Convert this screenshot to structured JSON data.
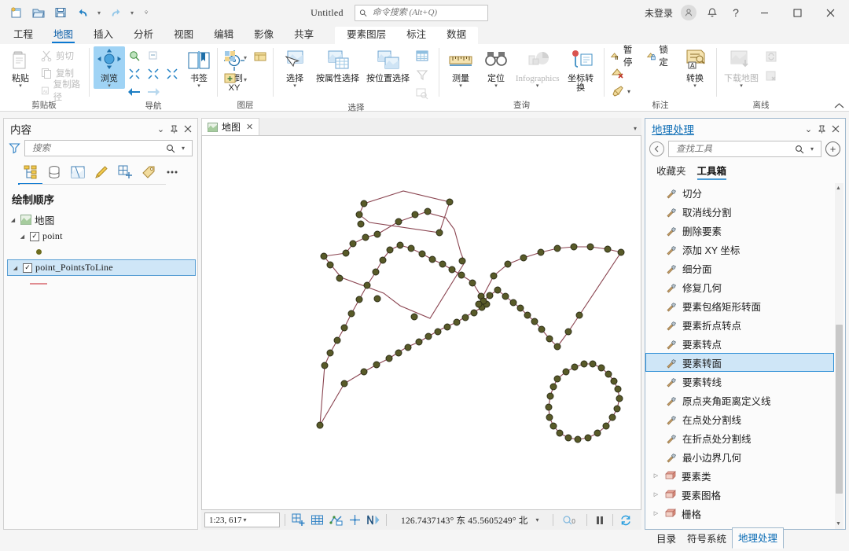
{
  "titlebar": {
    "app_title": "Untitled",
    "search_placeholder": "命令搜索 (Alt+Q)",
    "signin_label": "未登录",
    "qat": [
      {
        "name": "new-project-icon",
        "tip": "新建工程"
      },
      {
        "name": "open-project-icon",
        "tip": "打开工程"
      },
      {
        "name": "save-project-icon",
        "tip": "保存工程"
      },
      {
        "name": "undo-icon",
        "tip": "撤销"
      },
      {
        "name": "redo-icon",
        "tip": "重做"
      },
      {
        "name": "customize-qat-icon",
        "tip": "自定义快速访问工具栏"
      }
    ],
    "help_label": "?",
    "minimize_label": "—",
    "maximize_label": "□",
    "close_label": "✕"
  },
  "ribbon_tabs": {
    "main": [
      "工程",
      "地图",
      "插入",
      "分析",
      "视图",
      "编辑",
      "影像",
      "共享"
    ],
    "active": "地图",
    "contextual": [
      "要素图层",
      "标注",
      "数据"
    ]
  },
  "ribbon": {
    "groups": [
      {
        "label": "剪贴板",
        "big": {
          "label": "粘贴",
          "icon": "paste-icon",
          "caret": true
        },
        "small": [
          {
            "label": "剪切",
            "icon": "cut-icon",
            "dim": true
          },
          {
            "label": "复制",
            "icon": "copy-icon",
            "dim": true
          },
          {
            "label": "复制路径",
            "icon": "copy-path-icon",
            "dim": true
          }
        ]
      },
      {
        "label": "导航",
        "items": [
          {
            "label": "浏览",
            "icon": "explore-icon",
            "selected": true,
            "caret": true
          },
          {
            "label": "书签",
            "icon": "bookmarks-icon",
            "caret": true
          },
          {
            "label": "转到 XY",
            "icon": "go-to-xy-icon",
            "line2": "XY"
          }
        ],
        "minis": [
          "fixed-zoom-in-icon",
          "fixed-zoom-out-icon",
          "previous-extent-icon",
          "next-extent-icon",
          "full-extent-icon",
          "zoom-to-selection-icon"
        ]
      },
      {
        "label": "图层",
        "minis": [
          "layer-basemap-icon",
          "layer-list-icon",
          "add-data-icon"
        ]
      },
      {
        "label": "选择",
        "items": [
          {
            "label": "选择",
            "icon": "select-icon",
            "caret": true
          },
          {
            "label": "按属性选择",
            "icon": "select-by-attribute-icon"
          },
          {
            "label": "按位置选择",
            "icon": "select-by-location-icon"
          }
        ],
        "minis": [
          "attribute-table-icon",
          "selection-clear-icon",
          "zoom-to-selection2-icon"
        ]
      },
      {
        "label": "查询",
        "items": [
          {
            "label": "测量",
            "icon": "measure-icon",
            "caret": true
          },
          {
            "label": "定位",
            "icon": "locate-icon",
            "caret": true
          },
          {
            "label": "Infographics",
            "icon": "infographics-icon",
            "dim": true,
            "caret": true
          },
          {
            "label": "坐标转换",
            "icon": "coordinate-conversion-icon"
          }
        ]
      },
      {
        "label": "标注",
        "small": [
          {
            "label": "暂停",
            "icon": "pause-labeling-icon"
          },
          {
            "label": "锁定",
            "icon": "lock-labeling-icon"
          }
        ],
        "minis": [
          "clear-labels-icon",
          "label-style-icon"
        ],
        "big": {
          "label": "转换",
          "icon": "convert-labels-icon",
          "caret": true
        }
      },
      {
        "label": "离线",
        "big": {
          "label": "下载地图",
          "icon": "download-map-icon",
          "dim": true,
          "caret": true
        },
        "minis": [
          "sync-icon",
          "remove-offline-icon"
        ]
      }
    ]
  },
  "contents_panel": {
    "title": "内容",
    "search_placeholder": "搜索",
    "tools": [
      {
        "name": "drawing-order-icon",
        "active": true
      },
      {
        "name": "data-source-icon",
        "active": false
      },
      {
        "name": "selection-icon",
        "active": false
      },
      {
        "name": "editing-icon",
        "active": false
      },
      {
        "name": "snapping-icon",
        "active": false
      },
      {
        "name": "labeling-icon",
        "active": false
      },
      {
        "name": "more-options-icon",
        "active": false
      }
    ],
    "section_title": "绘制顺序",
    "tree": [
      {
        "label": "地图",
        "type": "map",
        "indent": 0,
        "checkbox": false,
        "expander": true
      },
      {
        "label": "point",
        "type": "point-layer",
        "indent": 1,
        "checkbox": true,
        "checked": true,
        "expander": true,
        "symbol": "point"
      },
      {
        "label": "point_PointsToLine",
        "type": "line-layer",
        "indent": 1,
        "checkbox": true,
        "checked": true,
        "expander": true,
        "symbol": "line",
        "selected": true
      }
    ],
    "point_symbol_color": "#6d6c1e",
    "line_symbol_color": "#e08c91"
  },
  "map_view": {
    "tab_label": "地图",
    "tab_close": "✕",
    "scale": "1:23, 617",
    "coordinates": "126.7437143° 东  45.5605249° 北",
    "status_icons": [
      "add-grid-icon",
      "grid-table-icon",
      "snapping-toggle-icon",
      "crosshair-icon",
      "north-arrow-icon"
    ],
    "right_status": {
      "selection_count": "0",
      "pause_icon": "pause-drawing-icon",
      "refresh_icon": "refresh-icon"
    },
    "line_color": "#8a4450",
    "point_fill": "#585a28",
    "point_stroke": "#32331a"
  },
  "geoprocessing_panel": {
    "title": "地理处理",
    "search_placeholder": "查找工具",
    "tabs": [
      {
        "label": "收藏夹",
        "active": false
      },
      {
        "label": "工具箱",
        "active": true
      }
    ],
    "tools": [
      {
        "label": "切分",
        "type": "tool"
      },
      {
        "label": "取消线分割",
        "type": "tool"
      },
      {
        "label": "删除要素",
        "type": "tool"
      },
      {
        "label": "添加 XY 坐标",
        "type": "tool"
      },
      {
        "label": "细分面",
        "type": "tool"
      },
      {
        "label": "修复几何",
        "type": "tool"
      },
      {
        "label": "要素包络矩形转面",
        "type": "tool"
      },
      {
        "label": "要素折点转点",
        "type": "tool"
      },
      {
        "label": "要素转点",
        "type": "tool"
      },
      {
        "label": "要素转面",
        "type": "tool",
        "selected": true
      },
      {
        "label": "要素转线",
        "type": "tool"
      },
      {
        "label": "原点夹角距离定义线",
        "type": "tool"
      },
      {
        "label": "在点处分割线",
        "type": "tool"
      },
      {
        "label": "在折点处分割线",
        "type": "tool"
      },
      {
        "label": "最小边界几何",
        "type": "tool"
      },
      {
        "label": "要素类",
        "type": "toolbox"
      },
      {
        "label": "要素图格",
        "type": "toolbox"
      },
      {
        "label": "栅格",
        "type": "toolbox"
      }
    ]
  },
  "bottom_tabs": [
    {
      "label": "目录",
      "active": false
    },
    {
      "label": "符号系统",
      "active": false
    },
    {
      "label": "地理处理",
      "active": true
    }
  ],
  "colors": {
    "accent": "#0b78d1",
    "selection_blue": "#cfe6f7",
    "selection_border": "#2e8fd6",
    "ribbon_bg": "#ffffff",
    "chrome_bg": "#f3f3f3"
  }
}
